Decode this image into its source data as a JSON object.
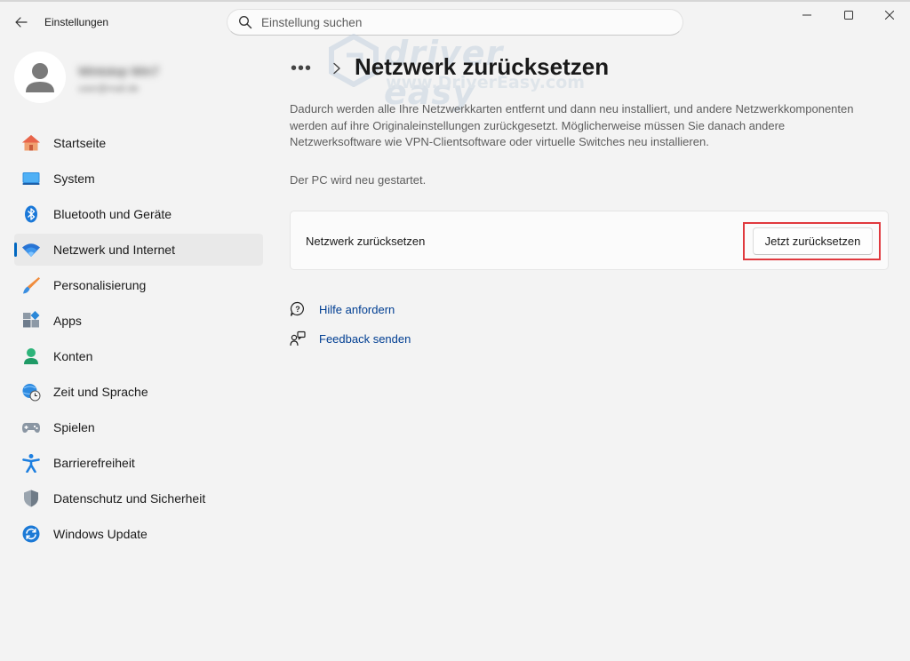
{
  "window": {
    "title": "Einstellungen",
    "controls": {
      "minimize": "minimize-icon",
      "maximize": "maximize-icon",
      "close": "close-icon"
    }
  },
  "search": {
    "placeholder": "Einstellung suchen",
    "value": ""
  },
  "profile": {
    "name": "Wintotop Win7",
    "email": "user@mail.de"
  },
  "sidebar": {
    "items": [
      {
        "label": "Startseite",
        "icon": "home-icon",
        "active": false
      },
      {
        "label": "System",
        "icon": "monitor-icon",
        "active": false
      },
      {
        "label": "Bluetooth und Geräte",
        "icon": "bluetooth-icon",
        "active": false
      },
      {
        "label": "Netzwerk und Internet",
        "icon": "wifi-icon",
        "active": true
      },
      {
        "label": "Personalisierung",
        "icon": "brush-icon",
        "active": false
      },
      {
        "label": "Apps",
        "icon": "apps-icon",
        "active": false
      },
      {
        "label": "Konten",
        "icon": "person-icon",
        "active": false
      },
      {
        "label": "Zeit und Sprache",
        "icon": "globe-clock-icon",
        "active": false
      },
      {
        "label": "Spielen",
        "icon": "gamepad-icon",
        "active": false
      },
      {
        "label": "Barrierefreiheit",
        "icon": "accessibility-icon",
        "active": false
      },
      {
        "label": "Datenschutz und Sicherheit",
        "icon": "shield-icon",
        "active": false
      },
      {
        "label": "Windows Update",
        "icon": "update-icon",
        "active": false
      }
    ]
  },
  "breadcrumb": {
    "more": "•••"
  },
  "main": {
    "title": "Netzwerk zurücksetzen",
    "description": "Dadurch werden alle Ihre Netzwerkkarten entfernt und dann neu installiert, und andere Netzwerkkomponenten werden auf ihre Originaleinstellungen zurückgesetzt. Möglicherweise müssen Sie danach andere Netzwerksoftware wie VPN-Clientsoftware oder virtuelle Switches neu installieren.",
    "note": "Der PC wird neu gestartet.",
    "card": {
      "label": "Netzwerk zurücksetzen",
      "button": "Jetzt zurücksetzen"
    },
    "links": [
      {
        "label": "Hilfe anfordern",
        "icon": "help-chat-icon"
      },
      {
        "label": "Feedback senden",
        "icon": "feedback-icon"
      }
    ]
  },
  "watermark": {
    "brand": "driver easy",
    "url": "www.DriverEasy.com"
  },
  "colors": {
    "accent": "#0067c0",
    "link": "#003e92",
    "highlight": "#e0393e",
    "background": "#f3f3f3"
  }
}
